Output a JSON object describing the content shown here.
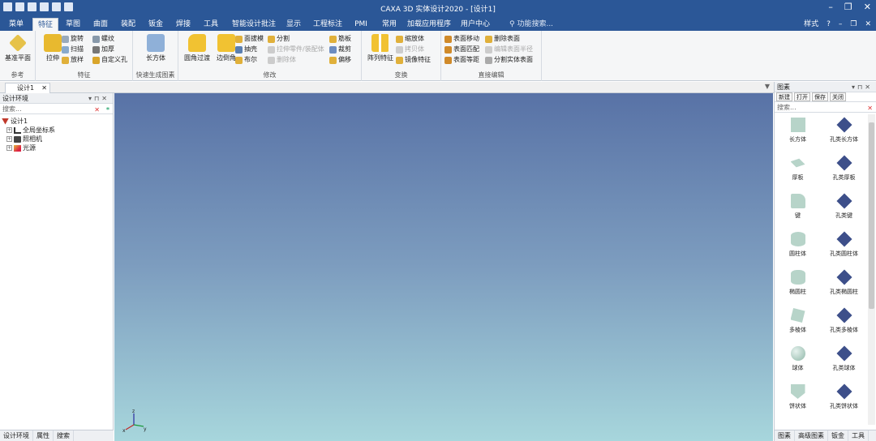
{
  "window": {
    "title": "CAXA 3D 实体设计2020 - [设计1]"
  },
  "menu": {
    "tabs": [
      "菜单",
      "特征",
      "草图",
      "曲面",
      "装配",
      "钣金",
      "焊接",
      "工具",
      "智能设计批注",
      "显示",
      "工程标注",
      "PMI",
      "常用",
      "加载应用程序",
      "用户中心"
    ],
    "active": "特征",
    "search_placeholder": "功能搜索...",
    "right_label": "样式"
  },
  "ribbon": {
    "groups": [
      {
        "label": "参考",
        "big": [
          "基准平面"
        ],
        "small": []
      },
      {
        "label": "特征",
        "big": [
          "拉伸"
        ],
        "small": [
          "旋转",
          "扫描",
          "放样",
          "螺纹",
          "加厚",
          "自定义孔"
        ]
      },
      {
        "label": "快速生成图素",
        "big": [
          "长方体"
        ],
        "small": []
      },
      {
        "label": "修改",
        "big": [
          "圆角过渡",
          "边倒角"
        ],
        "small": [
          "面拔模",
          "抽壳",
          "布尔",
          "分割",
          "拉伸零件/装配体",
          "删除体",
          "筋板",
          "裁剪",
          "偏移"
        ]
      },
      {
        "label": "变换",
        "big": [
          "阵列特征"
        ],
        "small": [
          "缩放体",
          "拷贝体",
          "镜像特征"
        ]
      },
      {
        "label": "直接编辑",
        "big": [],
        "small": [
          "表面移动",
          "表面匹配",
          "表面等距",
          "删除表面",
          "编辑表面半径",
          "分割实体表面"
        ]
      }
    ],
    "disabled_items": [
      "拉伸零件/装配体",
      "删除体",
      "拷贝体",
      "编辑表面半径"
    ]
  },
  "doc_tab": {
    "label": "设计1"
  },
  "left_panel": {
    "title": "设计环境",
    "search_placeholder": "搜索...",
    "tree": [
      {
        "label": "设计1",
        "level": 0
      },
      {
        "label": "全局坐标系",
        "level": 1
      },
      {
        "label": "照相机",
        "level": 1
      },
      {
        "label": "光源",
        "level": 1
      }
    ],
    "bottom_tabs": [
      "设计环境",
      "属性",
      "搜索"
    ]
  },
  "right_panel": {
    "title": "图素",
    "toolbar": [
      "新建",
      "打开",
      "保存",
      "关闭"
    ],
    "search_placeholder": "搜索...",
    "items": [
      {
        "label": "长方体"
      },
      {
        "label": "孔类长方体"
      },
      {
        "label": "厚板"
      },
      {
        "label": "孔类厚板"
      },
      {
        "label": "键"
      },
      {
        "label": "孔类键"
      },
      {
        "label": "圆柱体"
      },
      {
        "label": "孔类圆柱体"
      },
      {
        "label": "椭圆柱"
      },
      {
        "label": "孔类椭圆柱"
      },
      {
        "label": "多棱体"
      },
      {
        "label": "孔类多棱体"
      },
      {
        "label": "球体"
      },
      {
        "label": "孔类球体"
      },
      {
        "label": "饼状体"
      },
      {
        "label": "孔类饼状体"
      }
    ],
    "bottom_tabs": [
      "图素",
      "高级图素",
      "钣金",
      "工具"
    ]
  },
  "axis_labels": {
    "x": "x",
    "y": "y",
    "z": "z"
  },
  "colors": {
    "accent": "#2b5797",
    "viewport_top": "#5872a6",
    "viewport_bottom": "#a7d6dc"
  }
}
